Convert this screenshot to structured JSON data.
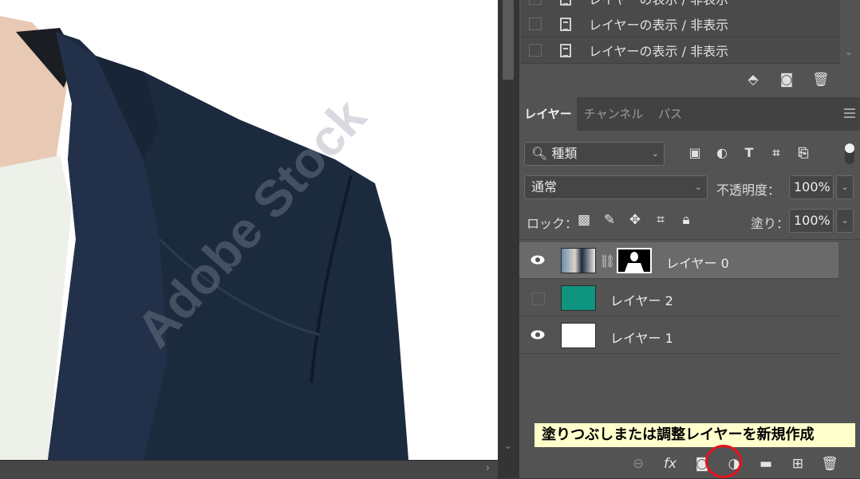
{
  "history": {
    "rows": [
      {
        "label": "レイヤーの表示 / 非表示"
      },
      {
        "label": "レイヤーの表示 / 非表示"
      },
      {
        "label": "レイヤーの表示 / 非表示"
      }
    ],
    "tools": [
      "new-document-from-state-icon",
      "camera-icon",
      "trash-icon"
    ]
  },
  "layers_panel": {
    "tabs": [
      {
        "label": "レイヤー",
        "active": true
      },
      {
        "label": "チャンネル",
        "active": false
      },
      {
        "label": "パス",
        "active": false
      }
    ],
    "filter": {
      "label": "種類"
    },
    "blend_mode": "通常",
    "opacity_label": "不透明度：",
    "opacity_value": "100%",
    "lock_label": "ロック：",
    "fill_label": "塗り：",
    "fill_value": "100%",
    "layers": [
      {
        "name": "レイヤー 0",
        "visible": true,
        "selected": true,
        "thumb_color": "#3b5a7a",
        "has_mask": true
      },
      {
        "name": "レイヤー 2",
        "visible": false,
        "selected": false,
        "thumb_color": "#0f9480",
        "has_mask": false
      },
      {
        "name": "レイヤー 1",
        "visible": true,
        "selected": false,
        "thumb_color": "#ffffff",
        "has_mask": false
      }
    ]
  },
  "canvas": {
    "watermark": "Adobe Stock"
  },
  "tooltip": {
    "text": "塗りつぶしまたは調整レイヤーを新規作成"
  },
  "bottom_tools": [
    "link-layers-icon",
    "fx-icon",
    "mask-icon",
    "adjustment-layer-icon",
    "group-folder-icon",
    "new-layer-icon",
    "trash-icon"
  ],
  "colors": {
    "panel_bg": "#535353",
    "selected_layer": "#6a6a6a",
    "tooltip_bg": "#ffffcc",
    "highlight_circle": "#e8101a"
  }
}
